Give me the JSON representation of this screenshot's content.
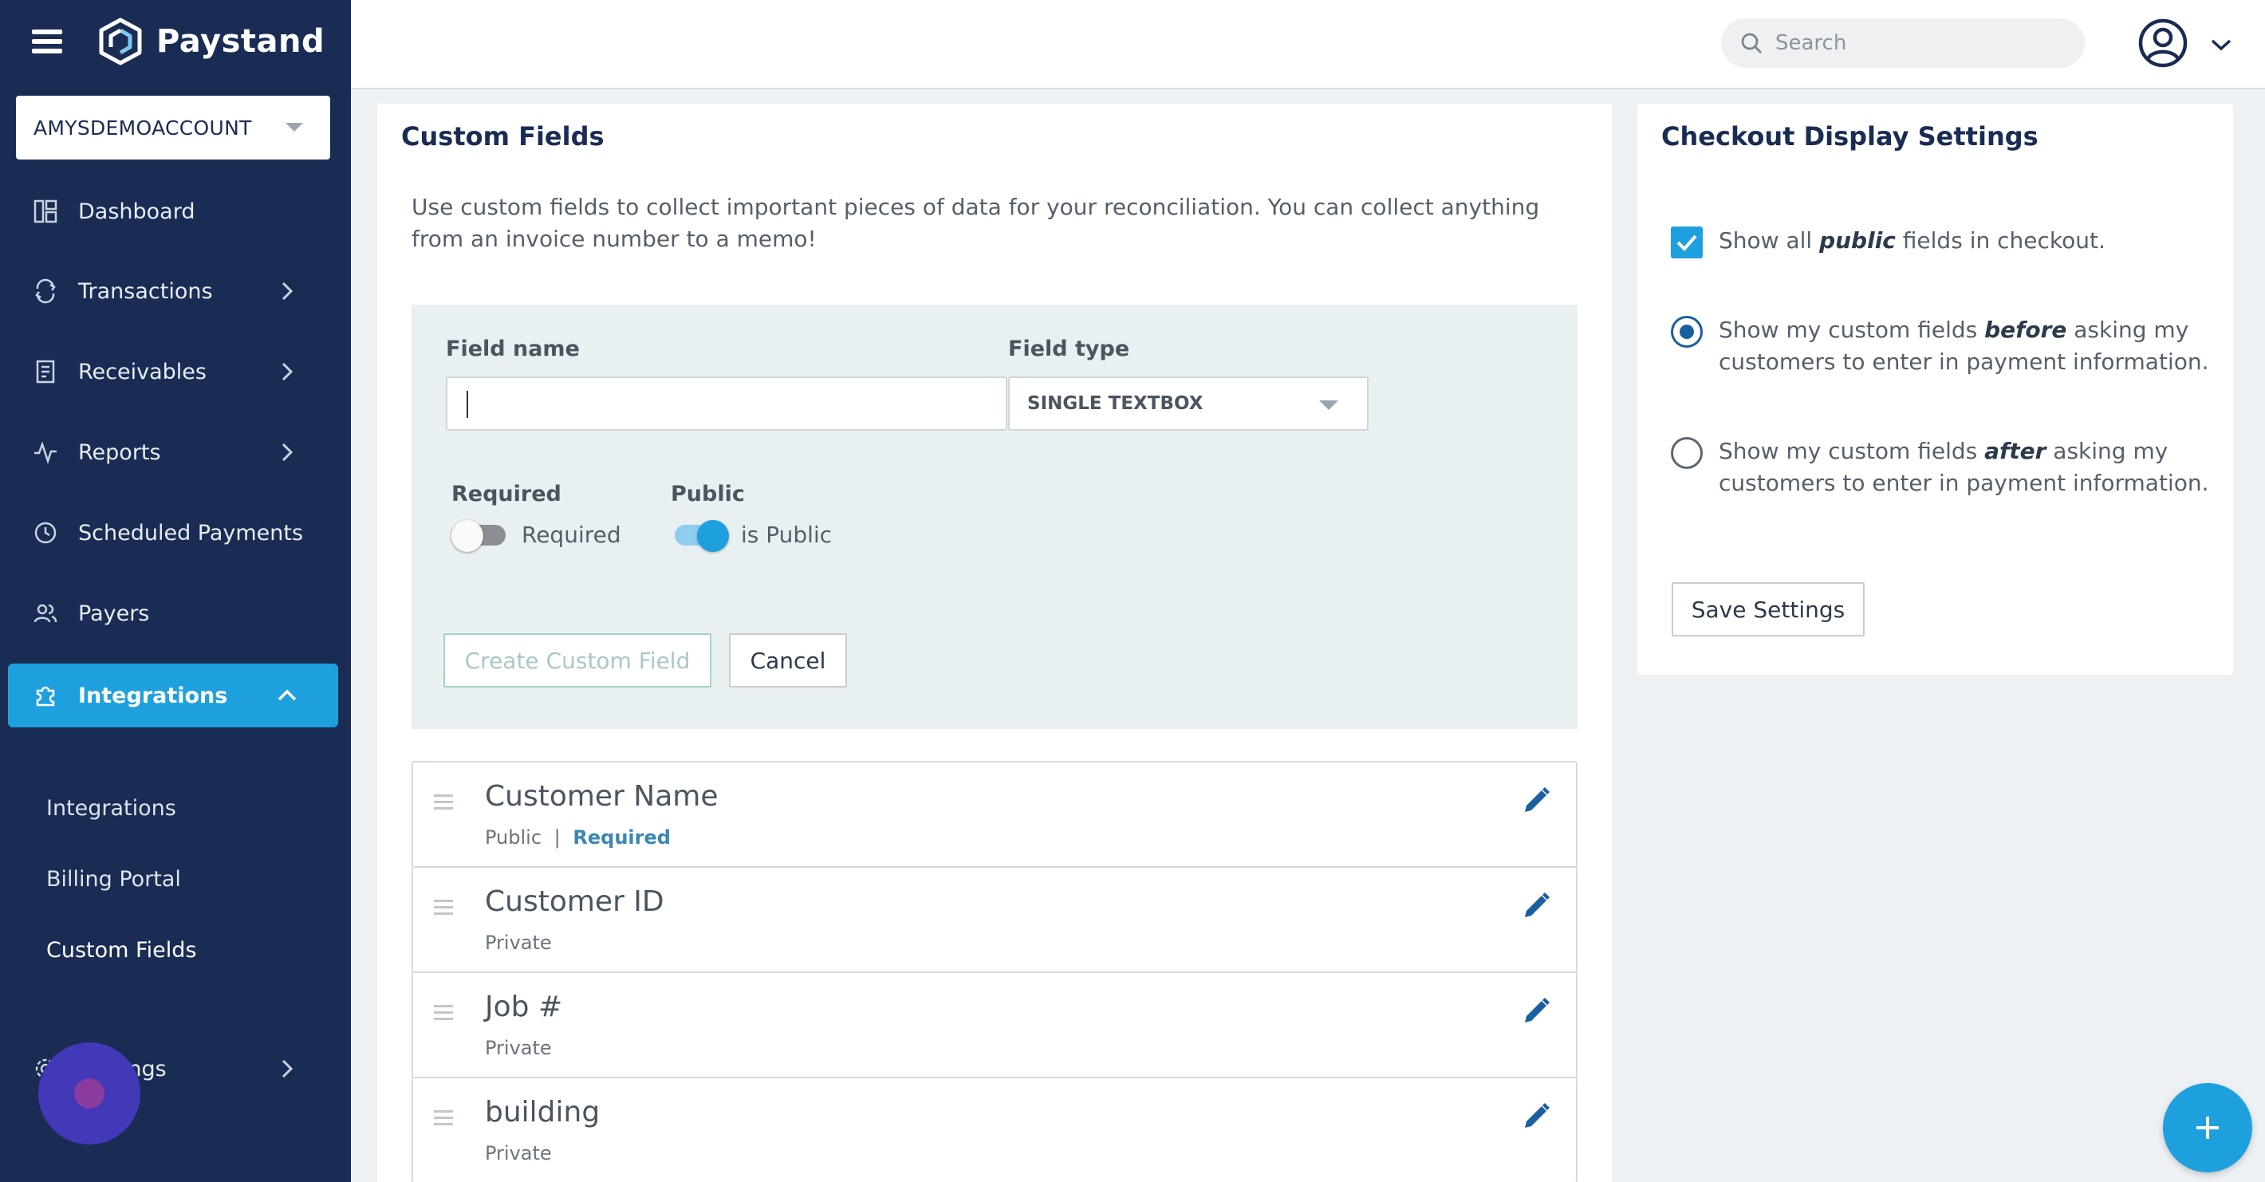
{
  "brand": {
    "name": "Paystand"
  },
  "account": {
    "name": "AMYSDEMOACCOUNT"
  },
  "nav": {
    "dashboard": "Dashboard",
    "transactions": "Transactions",
    "receivables": "Receivables",
    "reports": "Reports",
    "scheduled_payments": "Scheduled Payments",
    "payers": "Payers",
    "integrations": "Integrations",
    "settings": "Settings"
  },
  "subnav": {
    "integrations": "Integrations",
    "billing_portal": "Billing Portal",
    "custom_fields": "Custom Fields"
  },
  "topbar": {
    "search_placeholder": "Search"
  },
  "custom_fields": {
    "title": "Custom Fields",
    "description": "Use custom fields to collect important pieces of data for your reconciliation. You can collect anything from an invoice number to a memo!",
    "form": {
      "field_name_label": "Field name",
      "field_name_value": "",
      "field_type_label": "Field type",
      "field_type_value": "SINGLE TEXTBOX",
      "required_label": "Required",
      "required_toggle_text": "Required",
      "required_on": false,
      "public_label": "Public",
      "public_toggle_text": "is Public",
      "public_on": true,
      "create_button": "Create Custom Field",
      "cancel_button": "Cancel"
    },
    "fields": [
      {
        "name": "Customer Name",
        "visibility": "Public",
        "separator": "|",
        "required": "Required"
      },
      {
        "name": "Customer ID",
        "visibility": "Private"
      },
      {
        "name": "Job #",
        "visibility": "Private"
      },
      {
        "name": "building",
        "visibility": "Private"
      }
    ]
  },
  "checkout": {
    "title": "Checkout Display Settings",
    "show_public": {
      "pre": "Show all ",
      "em": "public",
      "post": " fields in checkout.",
      "checked": true
    },
    "before": {
      "pre": "Show my custom fields ",
      "em": "before",
      "post": " asking my customers to enter in payment information.",
      "selected": true
    },
    "after": {
      "pre": "Show my custom fields ",
      "em": "after",
      "post": " asking my customers to enter in payment information.",
      "selected": false
    },
    "save_button": "Save Settings"
  },
  "colors": {
    "sidebar": "#1a2c54",
    "accent": "#1ea0de",
    "required_text": "#3b86b3"
  }
}
